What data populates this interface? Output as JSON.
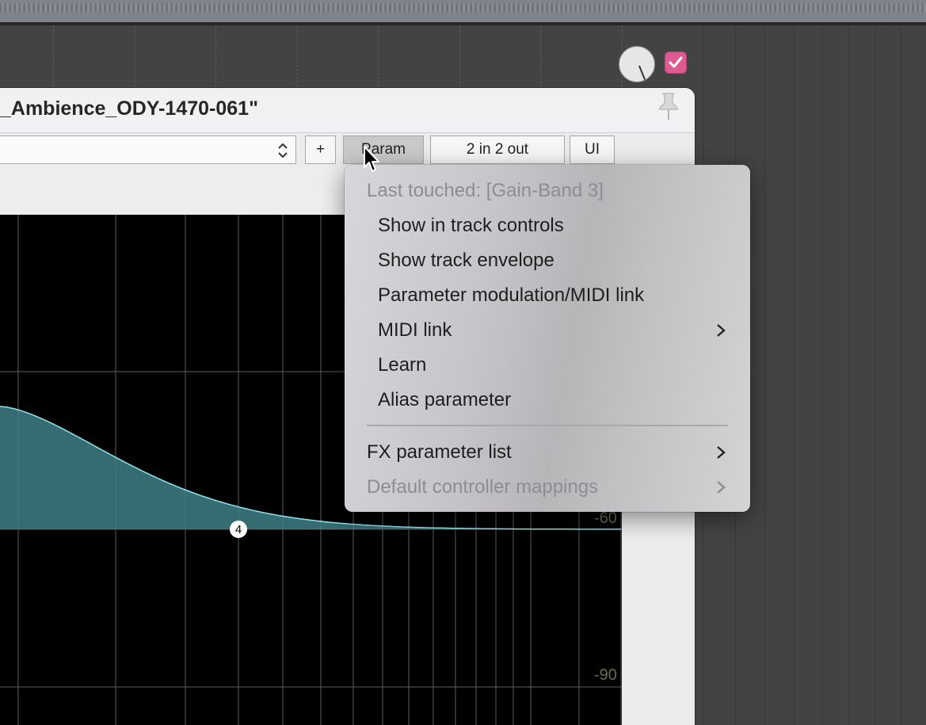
{
  "window": {
    "title": "_Ambience_ODY-1470-061\""
  },
  "toolbar": {
    "add_label": "+",
    "param_label": "Param",
    "io_label": "2 in 2 out",
    "ui_label": "UI"
  },
  "eq": {
    "band_label": "4",
    "db_labels": [
      "-60",
      "-90"
    ]
  },
  "context_menu": {
    "last_touched": "Last touched: [Gain-Band 3]",
    "items": [
      "Show in track controls",
      "Show track envelope",
      "Parameter modulation/MIDI link",
      "MIDI link",
      "Learn",
      "Alias parameter"
    ],
    "fx_parameter_list": "FX parameter list",
    "default_mappings": "Default controller mappings"
  },
  "colors": {
    "eq_curve": "#8fe3ee",
    "checkbox": "#dd5a93",
    "graph_bg": "#000000"
  }
}
